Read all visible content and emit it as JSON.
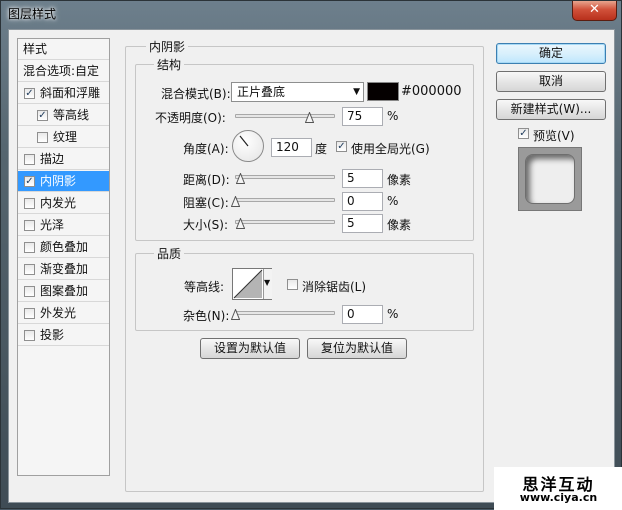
{
  "window": {
    "title": "图层样式",
    "close_glyph": "✕"
  },
  "styles_list": {
    "header": "样式",
    "blend_options": "混合选项:自定",
    "items": [
      {
        "label": "斜面和浮雕",
        "checked": true,
        "check_glyph": "✓"
      },
      {
        "label": "等高线",
        "checked": true,
        "check_glyph": "✓"
      },
      {
        "label": "纹理",
        "checked": false,
        "check_glyph": ""
      },
      {
        "label": "描边",
        "checked": false,
        "check_glyph": ""
      },
      {
        "label": "内阴影",
        "checked": true,
        "check_glyph": "✓"
      },
      {
        "label": "内发光",
        "checked": false,
        "check_glyph": ""
      },
      {
        "label": "光泽",
        "checked": false,
        "check_glyph": ""
      },
      {
        "label": "颜色叠加",
        "checked": false,
        "check_glyph": ""
      },
      {
        "label": "渐变叠加",
        "checked": false,
        "check_glyph": ""
      },
      {
        "label": "图案叠加",
        "checked": false,
        "check_glyph": ""
      },
      {
        "label": "外发光",
        "checked": false,
        "check_glyph": ""
      },
      {
        "label": "投影",
        "checked": false,
        "check_glyph": ""
      }
    ]
  },
  "inner_shadow": {
    "title": "内阴影",
    "structure": {
      "title": "结构",
      "blend_mode_label": "混合模式(B):",
      "blend_mode_value": "正片叠底",
      "dropdown_glyph": "▼",
      "color_hex": "#000000",
      "color_value": "#050000",
      "opacity_label": "不透明度(O):",
      "opacity_value": "75",
      "opacity_unit": "%",
      "opacity_fraction": 0.75,
      "angle_label": "角度(A):",
      "angle_value": "120",
      "angle_unit": "度",
      "use_global_light_label": "使用全局光(G)",
      "use_global_light_glyph": "✓",
      "distance_label": "距离(D):",
      "distance_value": "5",
      "distance_unit": "像素",
      "choke_label": "阻塞(C):",
      "choke_value": "0",
      "choke_unit": "%",
      "size_label": "大小(S):",
      "size_value": "5",
      "size_unit": "像素"
    },
    "quality": {
      "title": "品质",
      "contour_label": "等高线:",
      "anti_alias_label": "消除锯齿(L)",
      "noise_label": "杂色(N):",
      "noise_value": "0",
      "noise_unit": "%"
    },
    "make_default_button": "设置为默认值",
    "reset_default_button": "复位为默认值"
  },
  "actions": {
    "ok": "确定",
    "cancel": "取消",
    "new_style": "新建样式(W)...",
    "preview_label": "预览(V)",
    "preview_glyph": "✓"
  },
  "watermark": {
    "title": "思洋互动",
    "url": "www.ciya.cn"
  },
  "colors": {
    "selection": "#3399ff",
    "default_button": "#3c7fb1"
  }
}
